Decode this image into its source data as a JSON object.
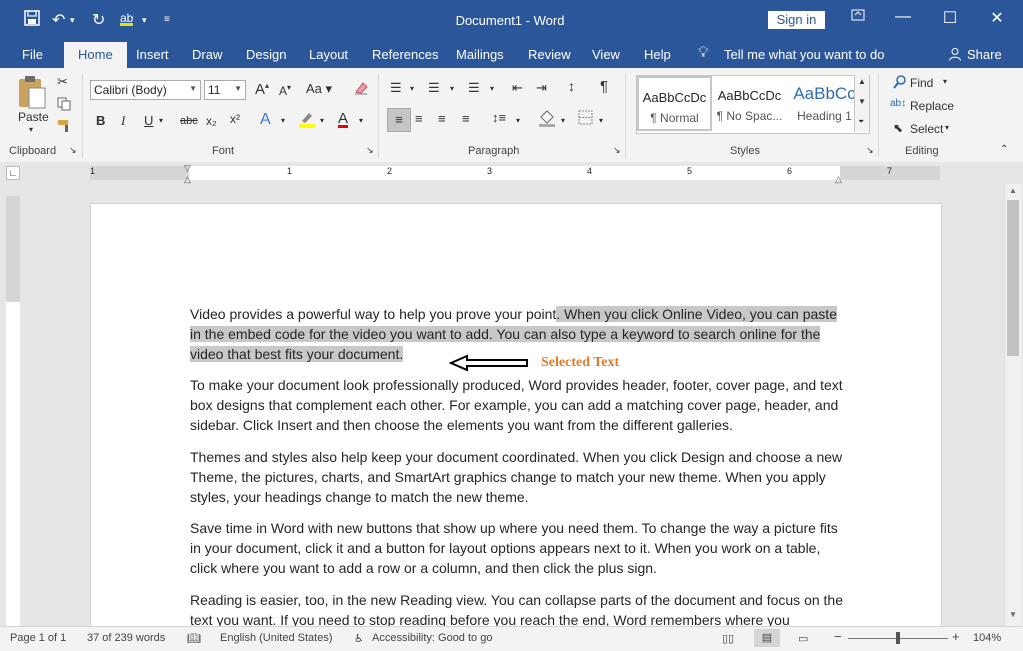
{
  "titlebar": {
    "document_title": "Document1 - Word",
    "sign_in": "Sign in"
  },
  "tabs": [
    "File",
    "Home",
    "Insert",
    "Draw",
    "Design",
    "Layout",
    "References",
    "Mailings",
    "Review",
    "View",
    "Help"
  ],
  "tell_me": "Tell me what you want to do",
  "share": "Share",
  "ribbon": {
    "clipboard": {
      "label": "Clipboard",
      "paste": "Paste"
    },
    "font": {
      "label": "Font",
      "font_name": "Calibri (Body)",
      "font_size": "11",
      "bold": "B",
      "italic": "I",
      "underline": "U",
      "strike": "abc",
      "subscript": "x₂",
      "superscript": "x²"
    },
    "paragraph": {
      "label": "Paragraph"
    },
    "styles": {
      "label": "Styles",
      "items": [
        {
          "preview": "AaBbCcDc",
          "name": "¶ Normal"
        },
        {
          "preview": "AaBbCcDc",
          "name": "¶ No Spac..."
        },
        {
          "preview": "AaBbCc",
          "name": "Heading 1"
        }
      ]
    },
    "editing": {
      "label": "Editing",
      "find": "Find",
      "replace": "Replace",
      "select": "Select"
    }
  },
  "ruler_numbers": [
    "1",
    "1",
    "2",
    "3",
    "4",
    "5",
    "6",
    "7"
  ],
  "document": {
    "p1_plain": "Video provides a powerful way to help you prove your point",
    "p1_selected": ". When you click Online Video, you can paste in the embed code for the video you want to add. You can also type a keyword to search online for the video that best fits your document.",
    "annotation": "Selected Text",
    "p2": "To make your document look professionally produced, Word provides header, footer, cover page, and text box designs that complement each other. For example, you can add a matching cover page, header, and sidebar. Click Insert and then choose the elements you want from the different galleries.",
    "p3": "Themes and styles also help keep your document coordinated. When you click Design and choose a new Theme, the pictures, charts, and SmartArt graphics change to match your new theme. When you apply styles, your headings change to match the new theme.",
    "p4": "Save time in Word with new buttons that show up where you need them. To change the way a picture fits in your document, click it and a button for layout options appears next to it. When you work on a table, click where you want to add a row or a column, and then click the plus sign.",
    "p5": "Reading is easier, too, in the new Reading view. You can collapse parts of the document and focus on the text you want. If you need to stop reading before you reach the end, Word remembers where you"
  },
  "statusbar": {
    "page": "Page 1 of 1",
    "words": "37 of 239 words",
    "language": "English (United States)",
    "accessibility": "Accessibility: Good to go",
    "zoom": "104%",
    "zoom_minus": "−",
    "zoom_plus": "+"
  },
  "colors": {
    "brand": "#2b579a",
    "annotation": "#e07b2a",
    "selection": "#c8c8c8"
  }
}
